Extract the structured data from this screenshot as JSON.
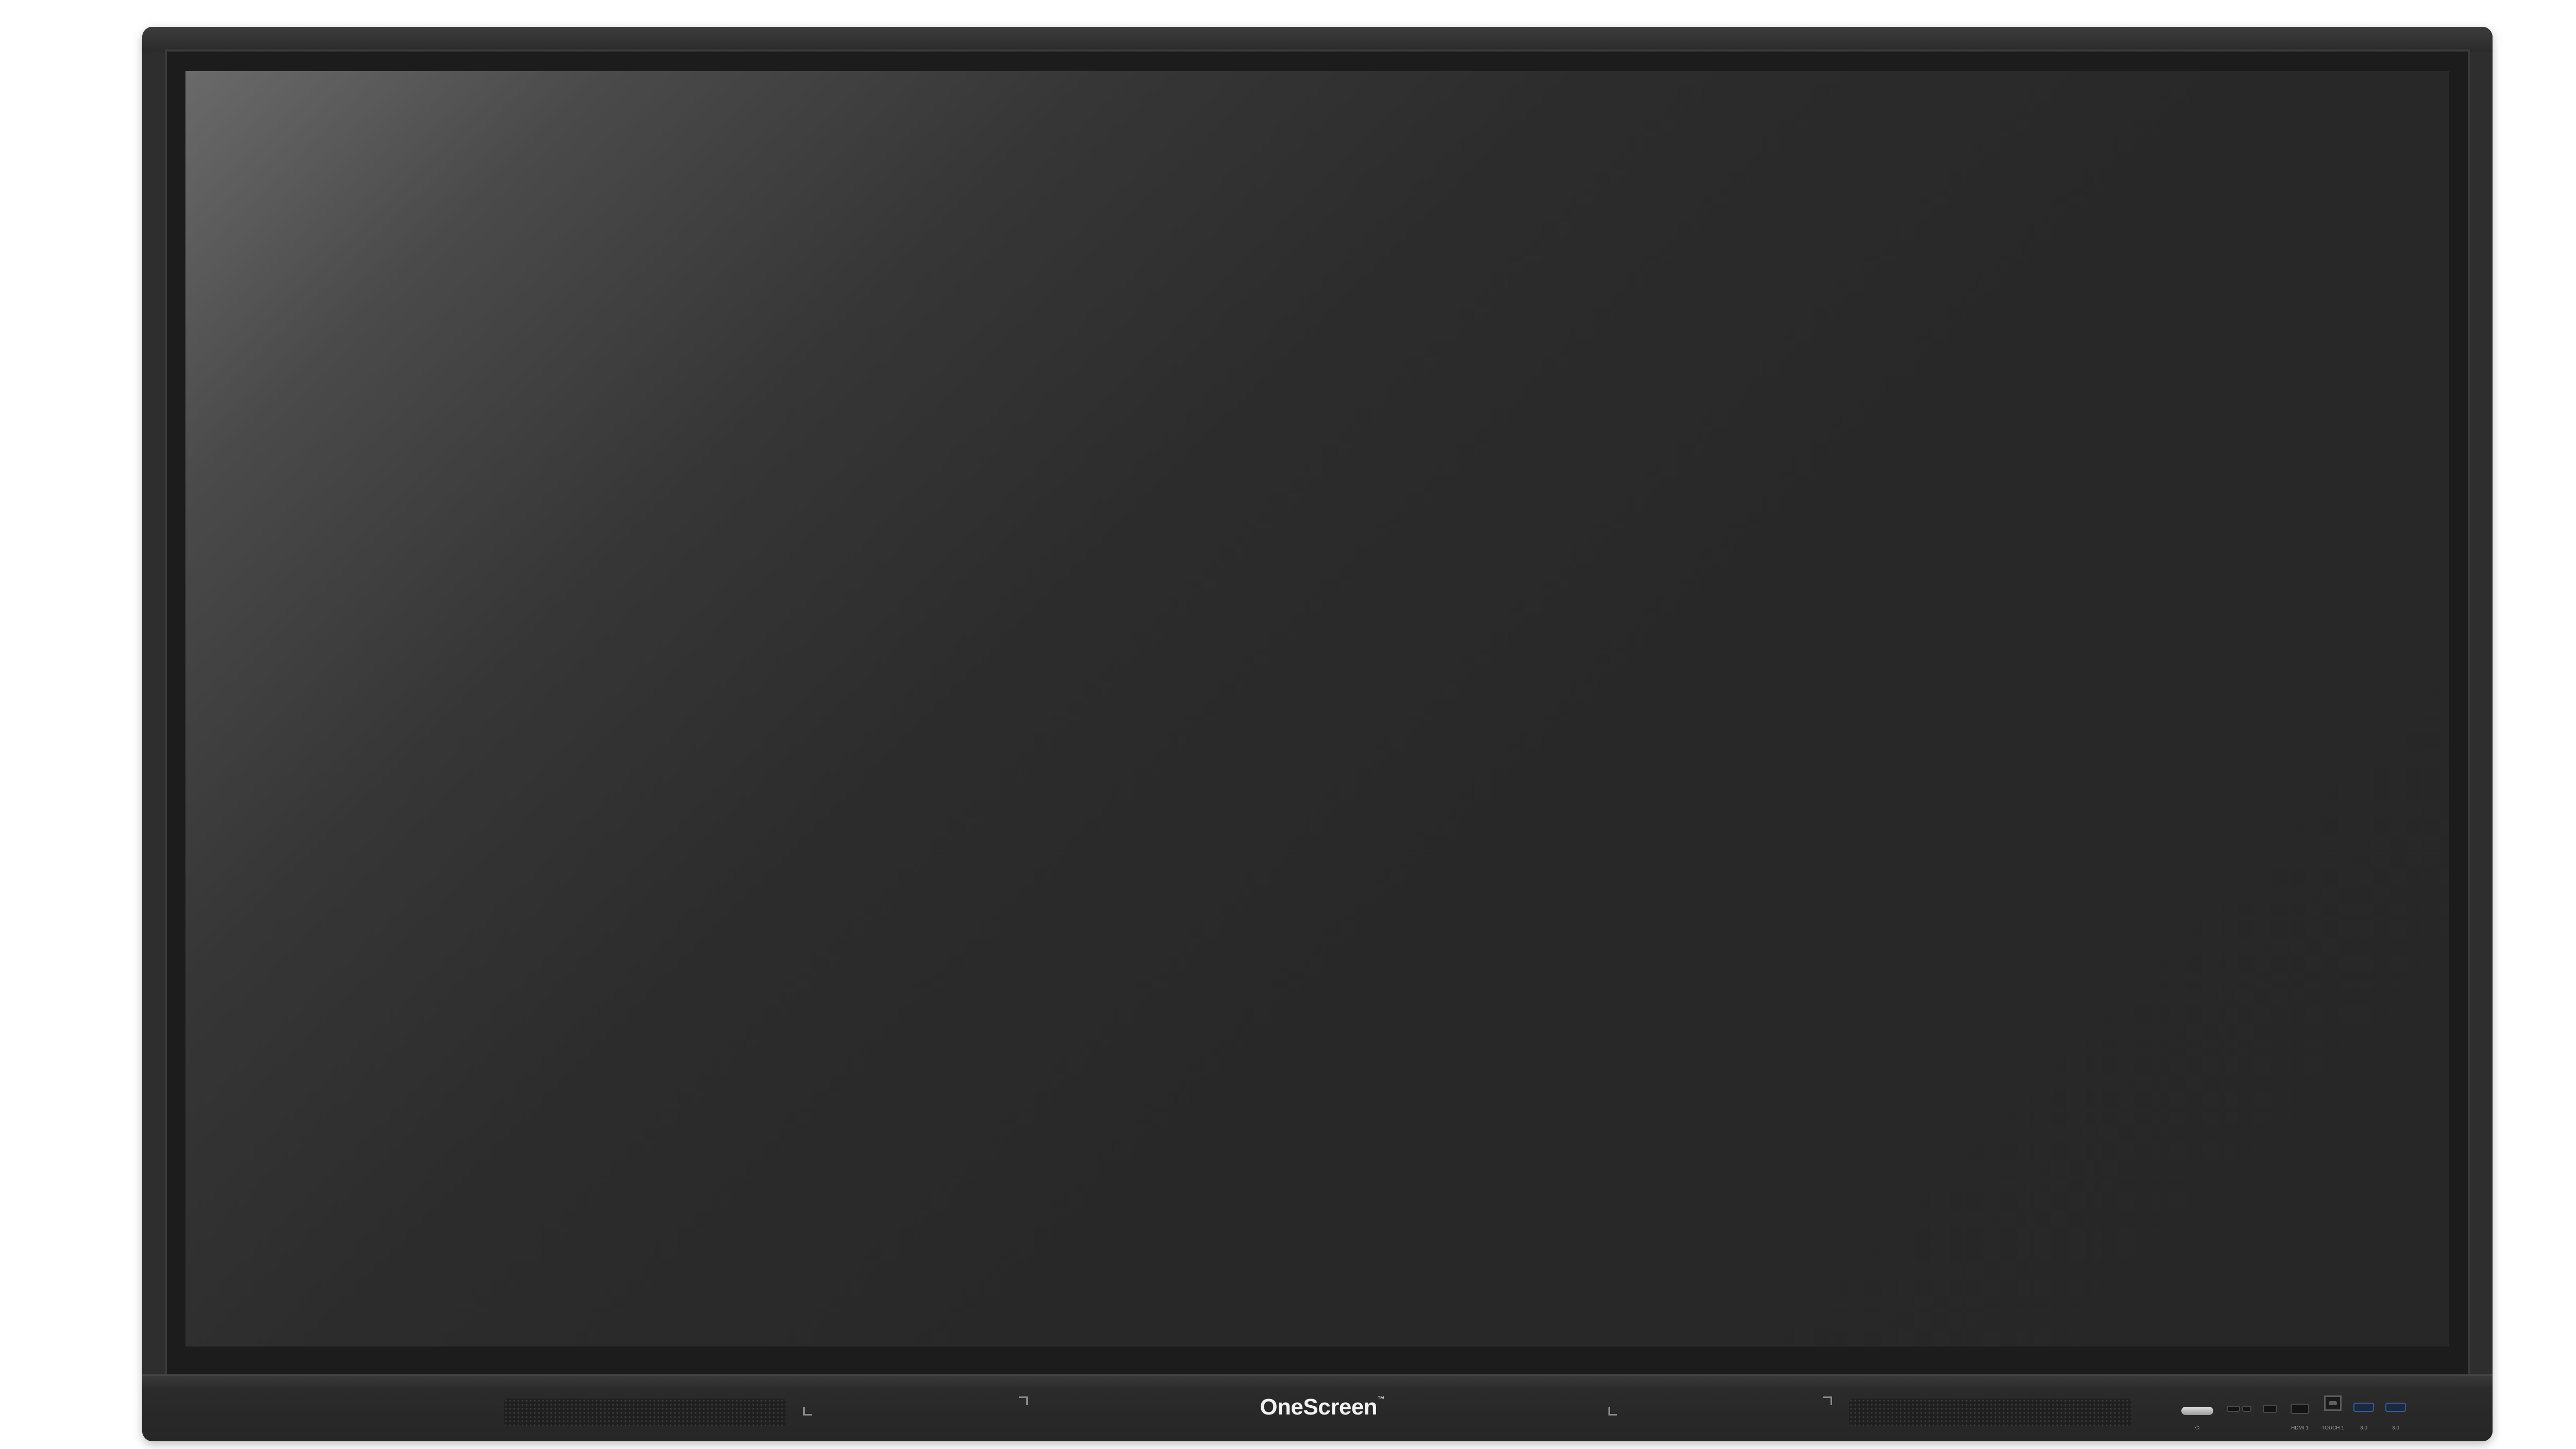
{
  "device": {
    "brand": "OneScreen",
    "trademark": "™",
    "screen_state": "off"
  },
  "ports": [
    {
      "id": "power",
      "label": "⏻"
    },
    {
      "id": "hdmi",
      "label": "HDMI 1"
    },
    {
      "id": "touch",
      "label": "TOUCH 1"
    },
    {
      "id": "usb1",
      "label": "3.0"
    },
    {
      "id": "usb2",
      "label": "3.0"
    }
  ],
  "colors": {
    "frame": "#2e2e2e",
    "screen": "#272727",
    "brand_text": "#f2f2f2"
  }
}
